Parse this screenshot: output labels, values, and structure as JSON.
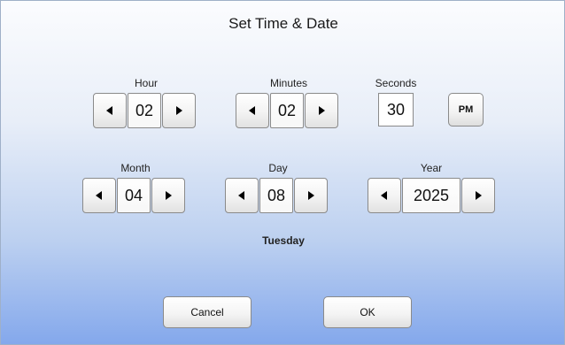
{
  "dialog": {
    "title": "Set Time & Date"
  },
  "time": {
    "hour": {
      "label": "Hour",
      "value": "02"
    },
    "minutes": {
      "label": "Minutes",
      "value": "02"
    },
    "seconds": {
      "label": "Seconds",
      "value": "30"
    },
    "ampm": "PM"
  },
  "date": {
    "month": {
      "label": "Month",
      "value": "04"
    },
    "day": {
      "label": "Day",
      "value": "08"
    },
    "year": {
      "label": "Year",
      "value": "2025"
    },
    "weekday": "Tuesday"
  },
  "actions": {
    "cancel_label": "Cancel",
    "ok_label": "OK"
  },
  "icons": {
    "decrement": "triangle-left-icon",
    "increment": "triangle-right-icon"
  },
  "colors": {
    "background_top": "#fbfcfe",
    "background_bottom": "#84a8ec",
    "button_border": "#8a8a8a"
  }
}
